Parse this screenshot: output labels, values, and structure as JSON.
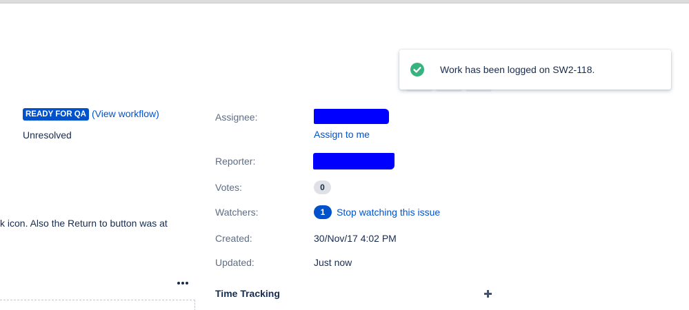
{
  "flag": {
    "icon": "check-circle-icon",
    "message": "Work has been logged on SW2-118."
  },
  "status": {
    "label": "READY FOR QA",
    "view_workflow": "(View workflow)",
    "resolution": "Unresolved"
  },
  "description": {
    "fragment": "k icon. Also the Return to button was at"
  },
  "people": {
    "assignee_label": "Assignee:",
    "assign_to_me": "Assign to me",
    "reporter_label": "Reporter:",
    "votes_label": "Votes:",
    "votes_count": "0",
    "watchers_label": "Watchers:",
    "watchers_count": "1",
    "stop_watching": "Stop watching this issue"
  },
  "dates": {
    "created_label": "Created:",
    "created_value": "30/Nov/17 4:02 PM",
    "updated_label": "Updated:",
    "updated_value": "Just now"
  },
  "time_tracking": {
    "title": "Time Tracking",
    "add_icon": "plus-icon"
  },
  "colors": {
    "accent": "#0052cc",
    "success": "#36b37e",
    "redaction": "#0000ff"
  }
}
